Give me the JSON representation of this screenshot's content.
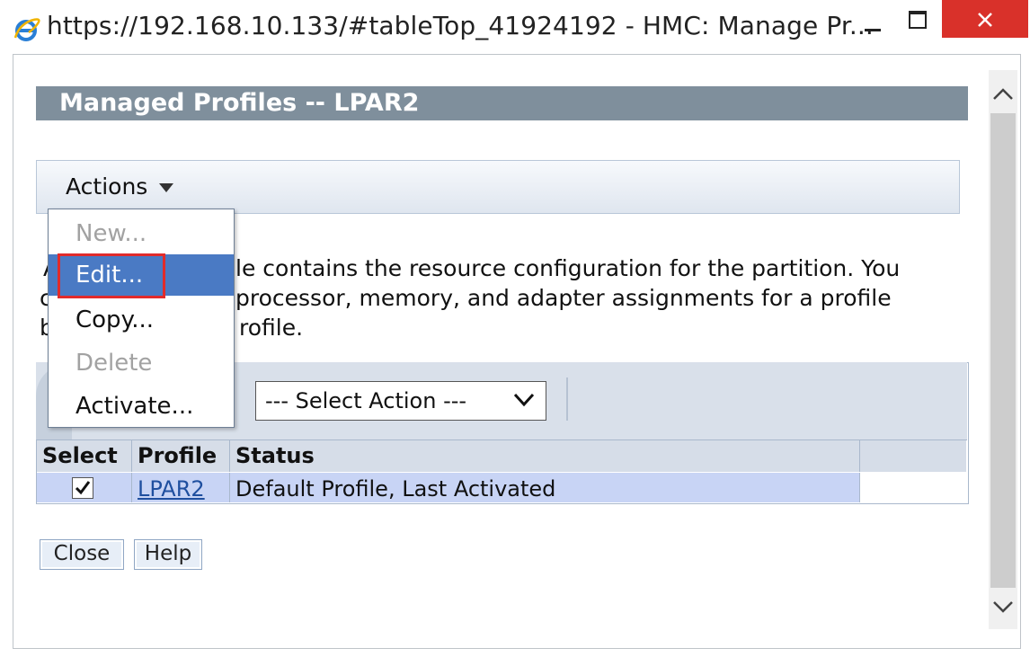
{
  "window": {
    "title": "https://192.168.10.133/#tableTop_41924192 - HMC: Manage Pr...",
    "icon": "internet-explorer-icon"
  },
  "page": {
    "header": "Managed Profiles -- LPAR2",
    "actions_label": "Actions",
    "intro_fragments": [
      "A",
      "le contains the resource configuration for the partition. You",
      "c",
      "processor, memory, and adapter assignments for a profile",
      "b",
      "rofile."
    ]
  },
  "menu": {
    "items": [
      {
        "label": "New...",
        "enabled": false
      },
      {
        "label": "Edit...",
        "enabled": true,
        "highlighted": true
      },
      {
        "label": "Copy...",
        "enabled": true
      },
      {
        "label": "Delete",
        "enabled": false
      },
      {
        "label": "Activate...",
        "enabled": true
      }
    ]
  },
  "table": {
    "select_action": "--- Select Action ---",
    "columns": [
      "Select",
      "Profile",
      "Status"
    ],
    "rows": [
      {
        "selected": true,
        "profile": "LPAR2",
        "status": "Default Profile, Last Activated"
      }
    ]
  },
  "buttons": {
    "close": "Close",
    "help": "Help"
  },
  "colors": {
    "header_bg": "#7f8f9c",
    "menu_highlight": "#4a7ac4",
    "close_button": "#d9312a",
    "row_selected": "#c8d4f5",
    "annotation_red": "#e12b2b"
  }
}
